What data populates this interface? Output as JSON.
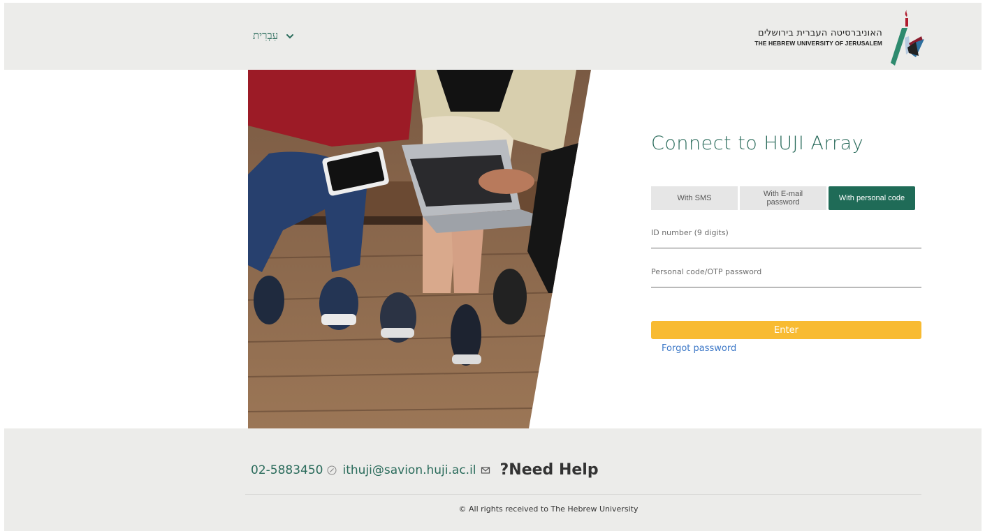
{
  "header": {
    "language_label": "עִבְרִית",
    "logo_hebrew": "האוניברסיטה העברית בירושלים",
    "logo_english": "THE HEBREW UNIVERSITY OF JERUSALEM"
  },
  "login": {
    "title": "Connect to HUJI Array",
    "tabs": [
      {
        "label": "With SMS",
        "active": false
      },
      {
        "label": "With E-mail password",
        "active": false
      },
      {
        "label": "With personal code",
        "active": true
      }
    ],
    "id_placeholder": "ID number (9 digits)",
    "code_placeholder": "Personal code/OTP password",
    "enter_label": "Enter",
    "forgot_label": "Forgot password"
  },
  "footer": {
    "phone": "02-5883450",
    "email": "ithuji@savion.huji.ac.il",
    "help_title": "?Need Help",
    "copyright": "© All rights received to The Hebrew University"
  },
  "colors": {
    "brand_green": "#1f6b57",
    "accent_yellow": "#f8bb32",
    "link_blue": "#3d78c7",
    "band_gray": "#ececea"
  }
}
